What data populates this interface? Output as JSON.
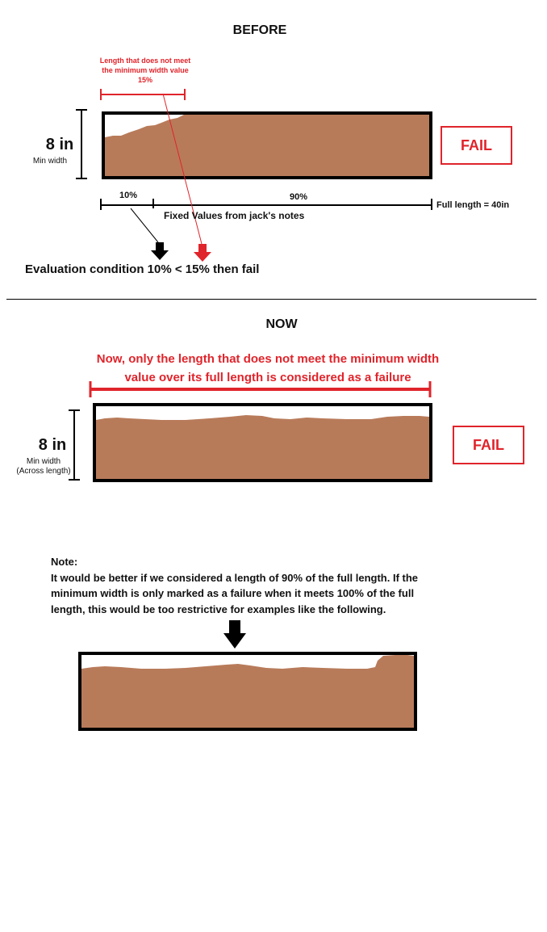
{
  "before": {
    "title": "BEFORE",
    "red_label": "Length that does not meet the minimum width value 15%",
    "width_value": "8 in",
    "width_caption": "Min width",
    "status": "FAIL",
    "seg_small": "10%",
    "seg_large": "90%",
    "full_length": "Full length = 40in",
    "fixed_values": "Fixed Values from jack's notes",
    "evaluation": "Evaluation condition 10% < 15% then fail"
  },
  "now": {
    "title": "NOW",
    "red_line1": "Now, only the length that does not meet the minimum width",
    "red_line2": "value over its full length is considered as a failure",
    "width_value": "8 in",
    "width_caption_1": "Min width",
    "width_caption_2": "(Across length)",
    "status": "FAIL"
  },
  "note": {
    "heading": "Note:",
    "line1": "It would be better if we considered a length of 90% of the full length. If the",
    "line2": "minimum width is only marked as a failure when it meets 100% of the full",
    "line3": "length, this would be too restrictive for examples like the following."
  },
  "colors": {
    "fill": "#b87b5a",
    "red": "#e0242b",
    "border": "#000000"
  }
}
